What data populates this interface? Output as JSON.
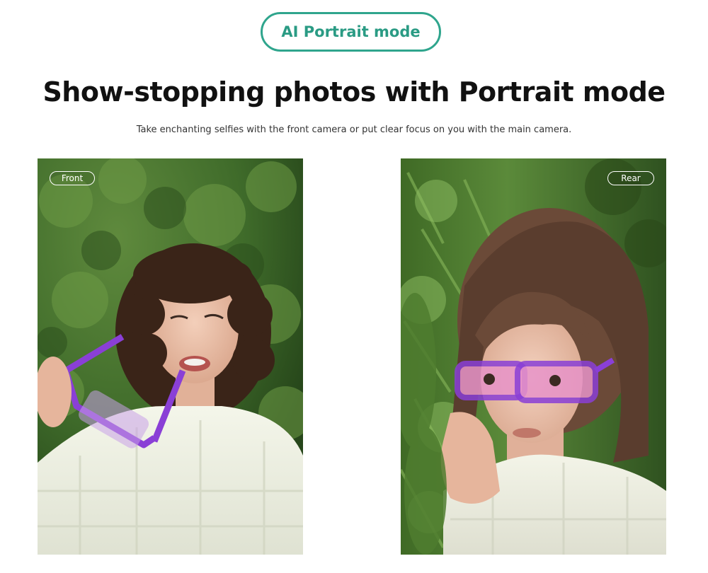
{
  "badge": {
    "label": "AI Portrait mode"
  },
  "headline": "Show-stopping photos with Portrait mode",
  "subline": "Take enchanting selfies with the front camera or put clear focus on you with the main camera.",
  "photos": [
    {
      "tag": "Front"
    },
    {
      "tag": "Rear"
    }
  ],
  "colors": {
    "accent": "#2fa58d",
    "foliage": "#3d6a2a",
    "glasses": "#8a3fd6",
    "sweater": "#eef0e4"
  }
}
